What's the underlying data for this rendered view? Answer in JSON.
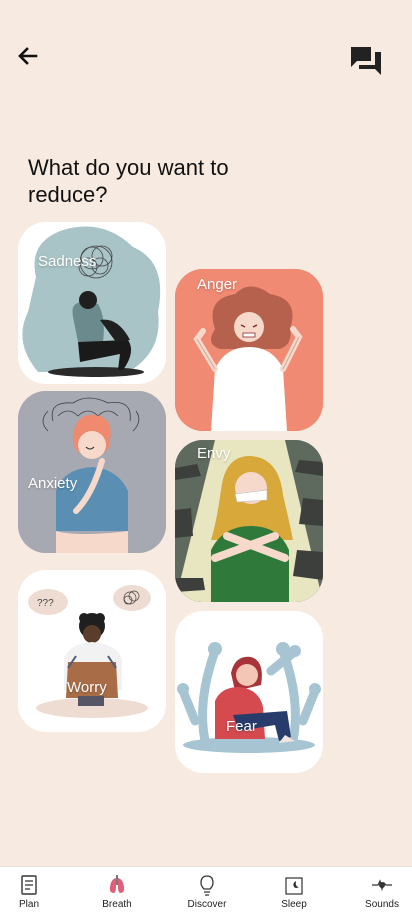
{
  "header": {
    "back_icon": "arrow-left-icon",
    "chat_icon": "chat-bubbles-icon"
  },
  "title": "What do you want to reduce?",
  "emotions": [
    {
      "label": "Sadness",
      "color": "#a9c4c7"
    },
    {
      "label": "Anger",
      "color": "#f08a73"
    },
    {
      "label": "Anxiety",
      "color": "#a6a9b1"
    },
    {
      "label": "Envy",
      "color": "#e8e6c0"
    },
    {
      "label": "Worry",
      "color": "#ffffff"
    },
    {
      "label": "Fear",
      "color": "#ffffff"
    }
  ],
  "bottom_nav": [
    {
      "label": "Plan",
      "icon": "notepad-icon"
    },
    {
      "label": "Breath",
      "icon": "lungs-icon"
    },
    {
      "label": "Discover",
      "icon": "lightbulb-icon"
    },
    {
      "label": "Sleep",
      "icon": "moon-window-icon"
    },
    {
      "label": "Sounds",
      "icon": "music-note-icon"
    }
  ]
}
